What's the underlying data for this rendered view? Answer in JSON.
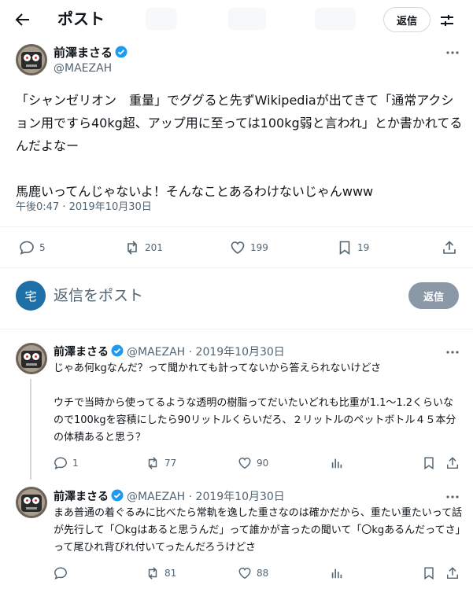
{
  "header": {
    "title": "ポスト",
    "reply_label": "返信"
  },
  "main_post": {
    "author_name": "前澤まさる",
    "handle": "@MAEZAH",
    "body": "「シャンゼリオン　重量」でググると先ずWikipediaが出てきて「通常アクション用ですら40kg超、アップ用に至っては100kg弱と言われ」とか書かれてるんだよなー\n\n馬鹿いってんじゃないよ！そんなことあるわけないじゃんwww",
    "timestamp": "午後0:47 · 2019年10月30日",
    "replies": "5",
    "reposts": "201",
    "likes": "199",
    "bookmarks": "19"
  },
  "composer": {
    "avatar_char": "宅",
    "placeholder": "返信をポスト",
    "button_label": "返信"
  },
  "replies": [
    {
      "author_name": "前澤まさる",
      "meta": "@MAEZAH · 2019年10月30日",
      "body": "じゃあ何kgなんだ？って聞かれても計ってないから答えられないけどさ\n\nウチで当時から使ってるような透明の樹脂ってだいたいどれも比重が1.1～1.2くらいなので100kgを容積にしたら90リットルくらいだろ、２リットルのペットボトル４５本分の体積あると思う？",
      "replies": "1",
      "reposts": "77",
      "likes": "90"
    },
    {
      "author_name": "前澤まさる",
      "meta": "@MAEZAH · 2019年10月30日",
      "body": "まあ普通の着ぐるみに比べたら常軌を逸した重さなのは確かだから、重たい重たいって話が先行して「〇kgはあると思うんだ」って誰かが言ったの聞いて「〇kgあるんだってさ」って尾ひれ背びれ付いてったんだろうけどさ",
      "replies": "",
      "reposts": "81",
      "likes": "88"
    }
  ],
  "colors": {
    "text": "#0f1419",
    "secondary": "#536471",
    "verified": "#1d9bf0",
    "divider": "#eff3f4",
    "composer_button": "#8b98a5"
  }
}
